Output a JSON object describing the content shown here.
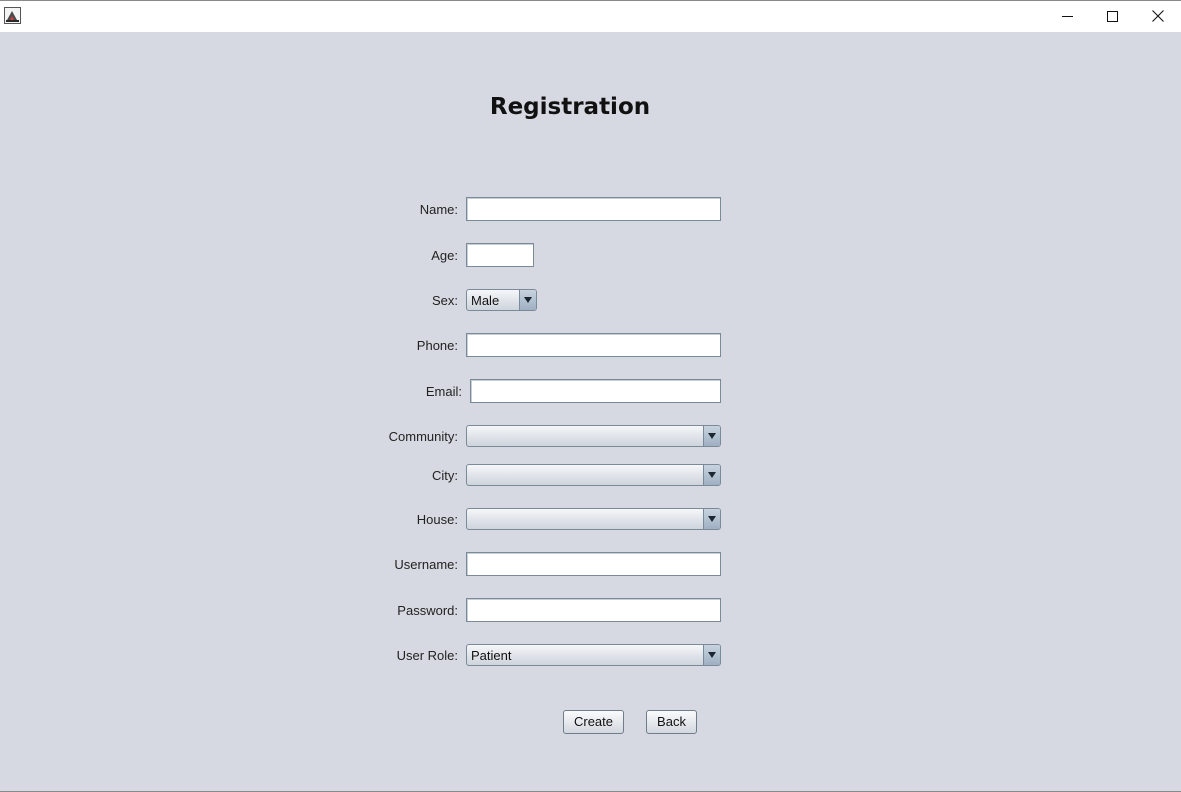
{
  "window": {
    "controls": {
      "minimize_icon": "minimize-icon",
      "maximize_icon": "maximize-icon",
      "close_icon": "close-icon"
    }
  },
  "form": {
    "title": "Registration",
    "name_label": "Name:",
    "name_value": "",
    "age_label": "Age:",
    "age_value": "",
    "sex_label": "Sex:",
    "sex_value": "Male",
    "phone_label": "Phone:",
    "phone_value": "",
    "email_label": "Email:",
    "email_value": "",
    "community_label": "Community:",
    "community_value": "",
    "city_label": "City:",
    "city_value": "",
    "house_label": "House:",
    "house_value": "",
    "username_label": "Username:",
    "username_value": "",
    "password_label": "Password:",
    "password_value": "",
    "role_label": "User Role:",
    "role_value": "Patient",
    "create_label": "Create",
    "back_label": "Back"
  },
  "colors": {
    "background": "#d6d9e1",
    "field_border": "#7a8a99"
  }
}
